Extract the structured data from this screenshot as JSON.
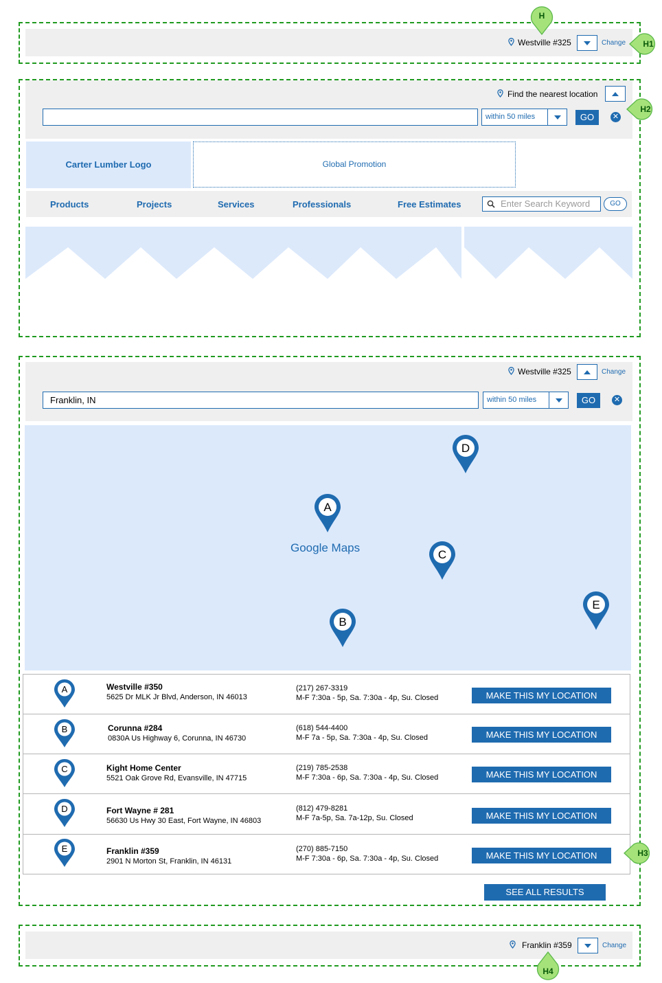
{
  "section_h1": {
    "location_name": "Westville #325",
    "change_label": "Change"
  },
  "section_h2": {
    "find_text": "Find the nearest location",
    "search_value": "",
    "radius_label": "within 50 miles",
    "go_label": "GO",
    "logo_text": "Carter Lumber Logo",
    "promo_text": "Global Promotion",
    "nav_items": [
      "Products",
      "Projects",
      "Services",
      "Professionals",
      "Free Estimates"
    ],
    "keyword_placeholder": "Enter Search Keyword",
    "keyword_go_label": "GO"
  },
  "section_h3": {
    "location_name": "Westville #325",
    "change_label": "Change",
    "search_value": "Franklin, IN",
    "radius_label": "within 50 miles",
    "go_label": "GO",
    "map_label": "Google Maps",
    "map_pins": [
      "A",
      "B",
      "C",
      "D",
      "E"
    ],
    "results": [
      {
        "letter": "A",
        "name": "Westville #350",
        "address": "5625 Dr MLK Jr Blvd, Anderson, IN 46013",
        "phone": "(217) 267-3319",
        "hours": "M-F 7:30a - 5p, Sa. 7:30a - 4p, Su. Closed",
        "button": "MAKE THIS MY LOCATION"
      },
      {
        "letter": "B",
        "name": "Corunna #284",
        "address": "0830A Us Highway 6, Corunna, IN 46730",
        "phone": "(618) 544-4400",
        "hours": "M-F 7a - 5p, Sa. 7:30a - 4p, Su. Closed",
        "button": "MAKE THIS MY LOCATION"
      },
      {
        "letter": "C",
        "name": "Kight Home Center",
        "address": "5521 Oak Grove Rd, Evansville, IN 47715",
        "phone": "(219) 785-2538",
        "hours": "M-F 7:30a - 6p, Sa. 7:30a - 4p, Su. Closed",
        "button": "MAKE THIS MY LOCATION"
      },
      {
        "letter": "D",
        "name": "Fort Wayne # 281",
        "address": "56630 Us Hwy 30 East, Fort Wayne, IN 46803",
        "phone": "(812) 479-8281",
        "hours": "M-F 7a-5p, Sa. 7a-12p, Su. Closed",
        "button": "MAKE THIS MY LOCATION"
      },
      {
        "letter": "E",
        "name": "Franklin #359",
        "address": "2901 N Morton St, Franklin, IN 46131",
        "phone": "(270) 885-7150",
        "hours": "M-F 7:30a - 6p, Sa. 7:30a - 4p, Su. Closed",
        "button": "MAKE THIS MY LOCATION"
      }
    ],
    "see_all_label": "SEE ALL RESULTS"
  },
  "section_h4": {
    "location_name": "Franklin #359",
    "change_label": "Change"
  },
  "annotations": {
    "h": "H",
    "h1": "H1",
    "h2": "H2",
    "h3": "H3",
    "h4": "H4"
  },
  "colors": {
    "accent": "#1f6bb0",
    "panel": "#efefef",
    "light_blue": "#dce9fb",
    "frame_green": "#1f9a1f",
    "annotation_fill": "#a6e27a"
  }
}
